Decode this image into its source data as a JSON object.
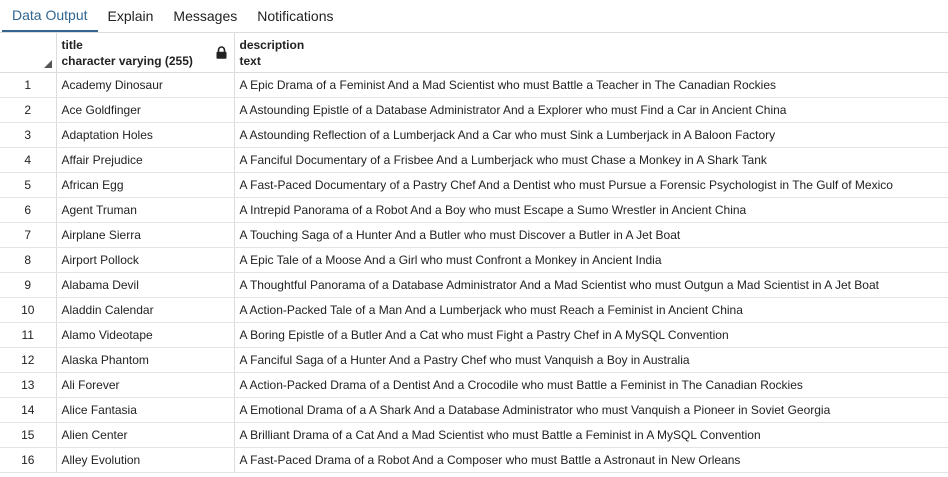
{
  "tabs": [
    {
      "label": "Data Output",
      "active": true
    },
    {
      "label": "Explain",
      "active": false
    },
    {
      "label": "Messages",
      "active": false
    },
    {
      "label": "Notifications",
      "active": false
    }
  ],
  "columns": [
    {
      "name": "title",
      "type": "character varying (255)",
      "locked": true
    },
    {
      "name": "description",
      "type": "text",
      "locked": false
    }
  ],
  "rows": [
    {
      "n": "1",
      "title": "Academy Dinosaur",
      "description": "A Epic Drama of a Feminist And a Mad Scientist who must Battle a Teacher in The Canadian Rockies"
    },
    {
      "n": "2",
      "title": "Ace Goldfinger",
      "description": "A Astounding Epistle of a Database Administrator And a Explorer who must Find a Car in Ancient China"
    },
    {
      "n": "3",
      "title": "Adaptation Holes",
      "description": "A Astounding Reflection of a Lumberjack And a Car who must Sink a Lumberjack in A Baloon Factory"
    },
    {
      "n": "4",
      "title": "Affair Prejudice",
      "description": "A Fanciful Documentary of a Frisbee And a Lumberjack who must Chase a Monkey in A Shark Tank"
    },
    {
      "n": "5",
      "title": "African Egg",
      "description": "A Fast-Paced Documentary of a Pastry Chef And a Dentist who must Pursue a Forensic Psychologist in The Gulf of Mexico"
    },
    {
      "n": "6",
      "title": "Agent Truman",
      "description": "A Intrepid Panorama of a Robot And a Boy who must Escape a Sumo Wrestler in Ancient China"
    },
    {
      "n": "7",
      "title": "Airplane Sierra",
      "description": "A Touching Saga of a Hunter And a Butler who must Discover a Butler in A Jet Boat"
    },
    {
      "n": "8",
      "title": "Airport Pollock",
      "description": "A Epic Tale of a Moose And a Girl who must Confront a Monkey in Ancient India"
    },
    {
      "n": "9",
      "title": "Alabama Devil",
      "description": "A Thoughtful Panorama of a Database Administrator And a Mad Scientist who must Outgun a Mad Scientist in A Jet Boat"
    },
    {
      "n": "10",
      "title": "Aladdin Calendar",
      "description": "A Action-Packed Tale of a Man And a Lumberjack who must Reach a Feminist in Ancient China"
    },
    {
      "n": "11",
      "title": "Alamo Videotape",
      "description": "A Boring Epistle of a Butler And a Cat who must Fight a Pastry Chef in A MySQL Convention"
    },
    {
      "n": "12",
      "title": "Alaska Phantom",
      "description": "A Fanciful Saga of a Hunter And a Pastry Chef who must Vanquish a Boy in Australia"
    },
    {
      "n": "13",
      "title": "Ali Forever",
      "description": "A Action-Packed Drama of a Dentist And a Crocodile who must Battle a Feminist in The Canadian Rockies"
    },
    {
      "n": "14",
      "title": "Alice Fantasia",
      "description": "A Emotional Drama of a A Shark And a Database Administrator who must Vanquish a Pioneer in Soviet Georgia"
    },
    {
      "n": "15",
      "title": "Alien Center",
      "description": "A Brilliant Drama of a Cat And a Mad Scientist who must Battle a Feminist in A MySQL Convention"
    },
    {
      "n": "16",
      "title": "Alley Evolution",
      "description": "A Fast-Paced Drama of a Robot And a Composer who must Battle a Astronaut in New Orleans"
    }
  ],
  "colors": {
    "accent": "#326690",
    "border": "#dcdcdc"
  }
}
